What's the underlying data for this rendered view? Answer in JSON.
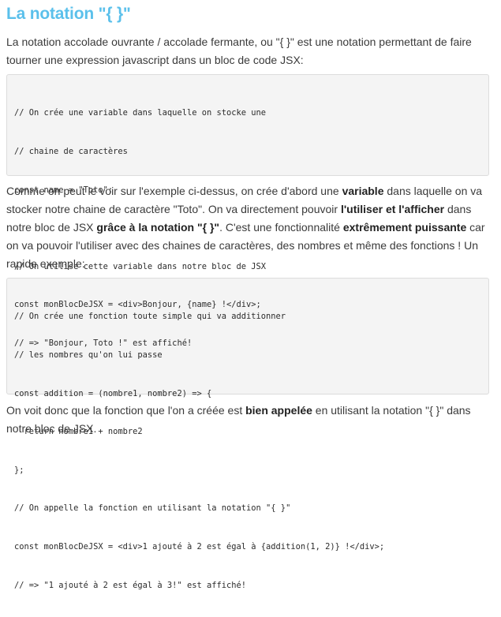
{
  "heading": "La notation \"{ }\"",
  "intro": {
    "text1": "La notation accolade ouvrante / accolade fermante, ou \"",
    "braces": "{ }",
    "text2": "\" est une notation permettant de faire tourner une expression javascript dans un bloc de code JSX:"
  },
  "code_block_1": {
    "lines": [
      "// On crée une variable dans laquelle on stocke une",
      "// chaine de caractères",
      "const name = \"Toto\";",
      "",
      "// On utilise cette variable dans notre bloc de JSX",
      "const monBlocDeJSX = <div>Bonjour, {name} !</div>;",
      "// => \"Bonjour, Toto !\" est affiché!"
    ]
  },
  "explanation": {
    "t1": "Comme on peut le voir sur l'exemple ci-dessus, on crée d'abord une ",
    "b1": "variable",
    "t2": " dans laquelle on va stocker notre chaine de caractère \"Toto\". On va directement pouvoir ",
    "b2": "l'utiliser et l'afficher",
    "t3": " dans notre bloc de JSX ",
    "b3": "grâce à la notation \"{ }\"",
    "t4": ". C'est une fonctionnalité ",
    "b4": "extrêmement puissante",
    "t5": " car on va pouvoir l'utiliser avec des chaines de caractères, des nombres et même des fonctions ! Un rapide exemple:"
  },
  "code_block_2": {
    "lines": [
      "// On crée une fonction toute simple qui va additionner",
      "// les nombres qu'on lui passe",
      "const addition = (nombre1, nombre2) => {",
      "  return nombre1 + nombre2",
      "};",
      "// On appelle la fonction en utilisant la notation \"{ }\"",
      "const monBlocDeJSX = <div>1 ajouté à 2 est égal à {addition(1, 2)} !</div>;",
      "// => \"1 ajouté à 2 est égal à 3!\" est affiché!"
    ]
  },
  "outro": {
    "t1": "On voit donc que la fonction que l'on a créée est ",
    "b1": "bien appelée",
    "t2": " en utilisant la notation \"",
    "braces": "{ }",
    "t3": "\" dans notre bloc de JSX."
  }
}
